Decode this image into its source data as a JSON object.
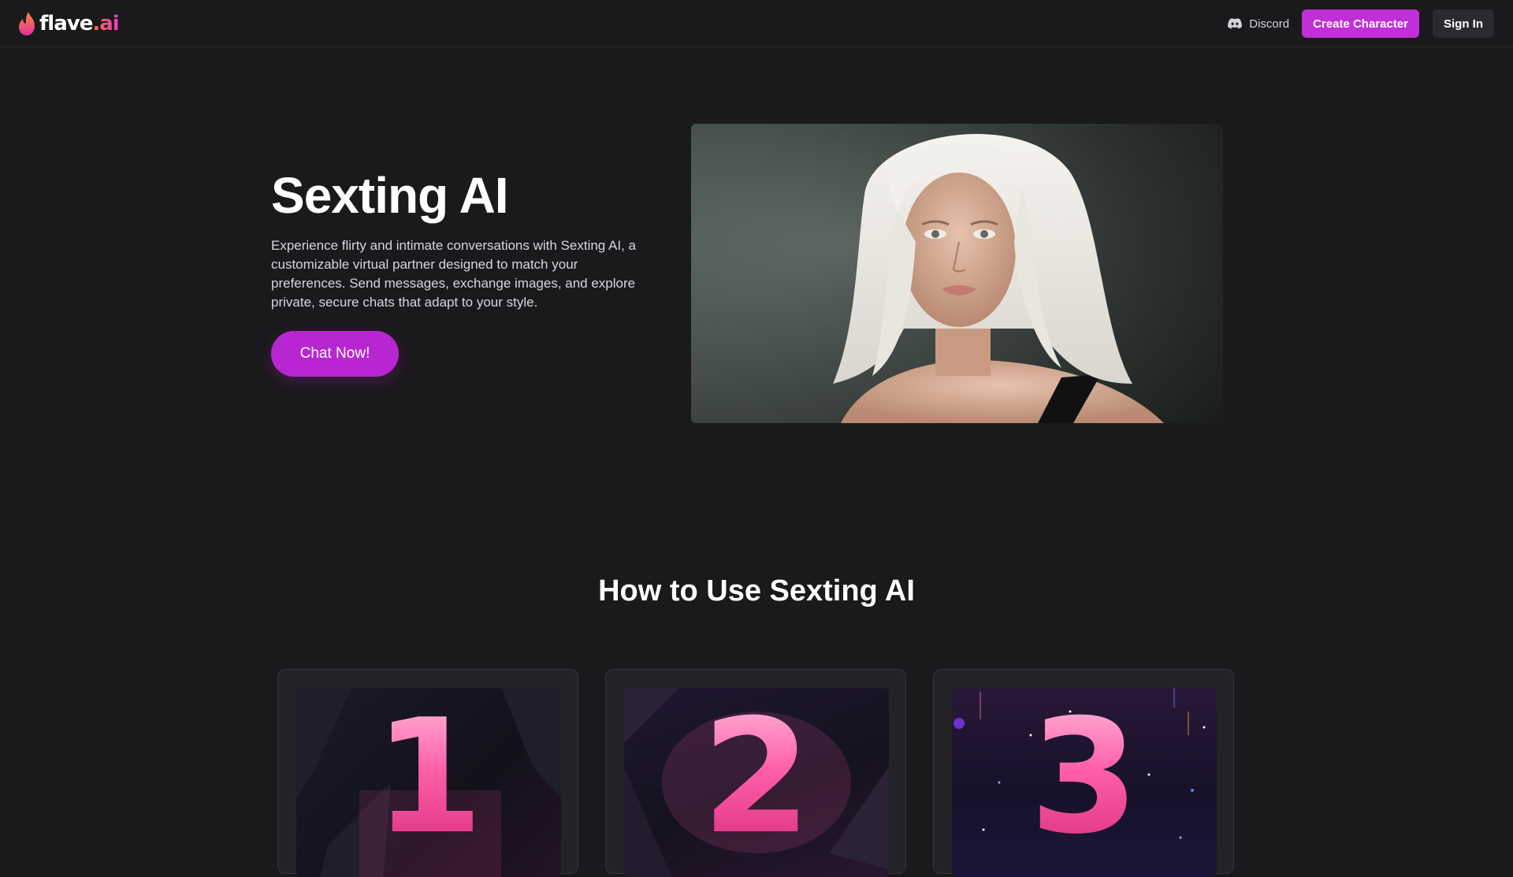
{
  "header": {
    "logo_text_main": "flave",
    "logo_text_accent": ".ai",
    "discord_label": "Discord",
    "create_label": "Create Character",
    "signin_label": "Sign In"
  },
  "hero": {
    "title": "Sexting AI",
    "description": "Experience flirty and intimate conversations with Sexting AI, a customizable virtual partner designed to match your preferences. Send messages, exchange images, and explore private, secure chats that adapt to your style.",
    "cta_label": "Chat Now!"
  },
  "how_to": {
    "title": "How to Use Sexting AI",
    "steps": [
      {
        "number": "1"
      },
      {
        "number": "2"
      },
      {
        "number": "3"
      }
    ]
  },
  "colors": {
    "background": "#1a191b",
    "accent": "#c12fd8",
    "cta": "#b826d1",
    "secondary_button": "#2b2a2e"
  },
  "icons": {
    "logo": "flame-icon",
    "discord": "discord-icon"
  }
}
